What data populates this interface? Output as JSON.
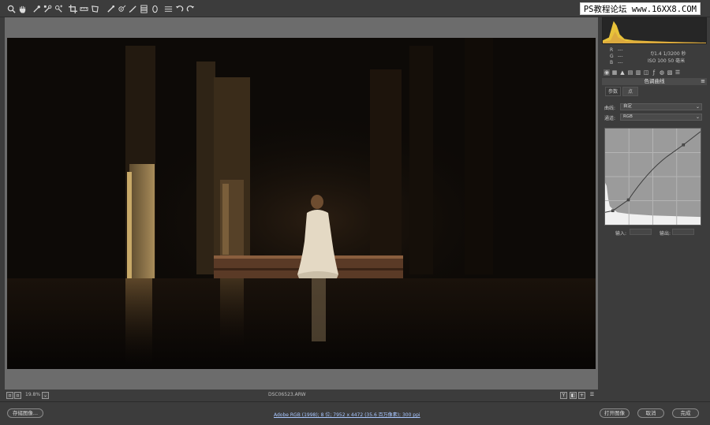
{
  "toolbar": {
    "tools": [
      {
        "name": "zoom-tool",
        "icon": "magnifier-icon"
      },
      {
        "name": "hand-tool",
        "icon": "hand-icon"
      },
      {
        "name": "white-balance-tool",
        "icon": "eyedropper-icon"
      },
      {
        "name": "color-sampler-tool",
        "icon": "sampler-icon"
      },
      {
        "name": "targeted-adjustment-tool",
        "icon": "target-adjust-icon"
      },
      {
        "name": "crop-tool",
        "icon": "crop-icon"
      },
      {
        "name": "straighten-tool",
        "icon": "straighten-icon"
      },
      {
        "name": "transform-tool",
        "icon": "transform-icon"
      },
      {
        "name": "spot-removal-tool",
        "icon": "brush-heal-icon"
      },
      {
        "name": "red-eye-tool",
        "icon": "red-eye-icon"
      },
      {
        "name": "adjustment-brush-tool",
        "icon": "brush-icon"
      },
      {
        "name": "graduated-filter-tool",
        "icon": "gradient-icon"
      },
      {
        "name": "radial-filter-tool",
        "icon": "radial-icon"
      },
      {
        "name": "preferences-tool",
        "icon": "list-icon"
      },
      {
        "name": "rotate-left-tool",
        "icon": "rotate-ccw-icon"
      },
      {
        "name": "rotate-right-tool",
        "icon": "rotate-cw-icon"
      }
    ],
    "watermark": "PS教程论坛 www.16XX8.COM"
  },
  "preview": {
    "zoom_value": "19.8%",
    "filename": "DSC06523.ARW"
  },
  "right_panel": {
    "readout": {
      "r_label": "R",
      "g_label": "G",
      "b_label": "B",
      "r_value": "---",
      "g_value": "---",
      "b_value": "---",
      "exposure": "f/1.4   1/3200 秒",
      "iso": "ISO 100   50 毫米"
    },
    "panel_title": "色调曲线",
    "panel_menu": "≡",
    "subtabs": [
      "参数",
      "点"
    ],
    "curve_label": "曲线:",
    "curve_value": "自定",
    "channel_label": "通道:",
    "channel_value": "RGB",
    "input_label": "输入:",
    "output_label": "输出:"
  },
  "bottom": {
    "save_button": "存储图像...",
    "workflow_text": "Adobe RGB (1998); 8 位; 7952 x 4472 (35.6 百万像素); 300 ppi",
    "open_button": "打开图像",
    "cancel_button": "取消",
    "done_button": "完成"
  },
  "colors": {
    "ui_background": "#3c3c3c",
    "preview_background": "#6c6c6c",
    "histogram_yellow": "#e8c23a",
    "link": "#a9c7ff"
  }
}
